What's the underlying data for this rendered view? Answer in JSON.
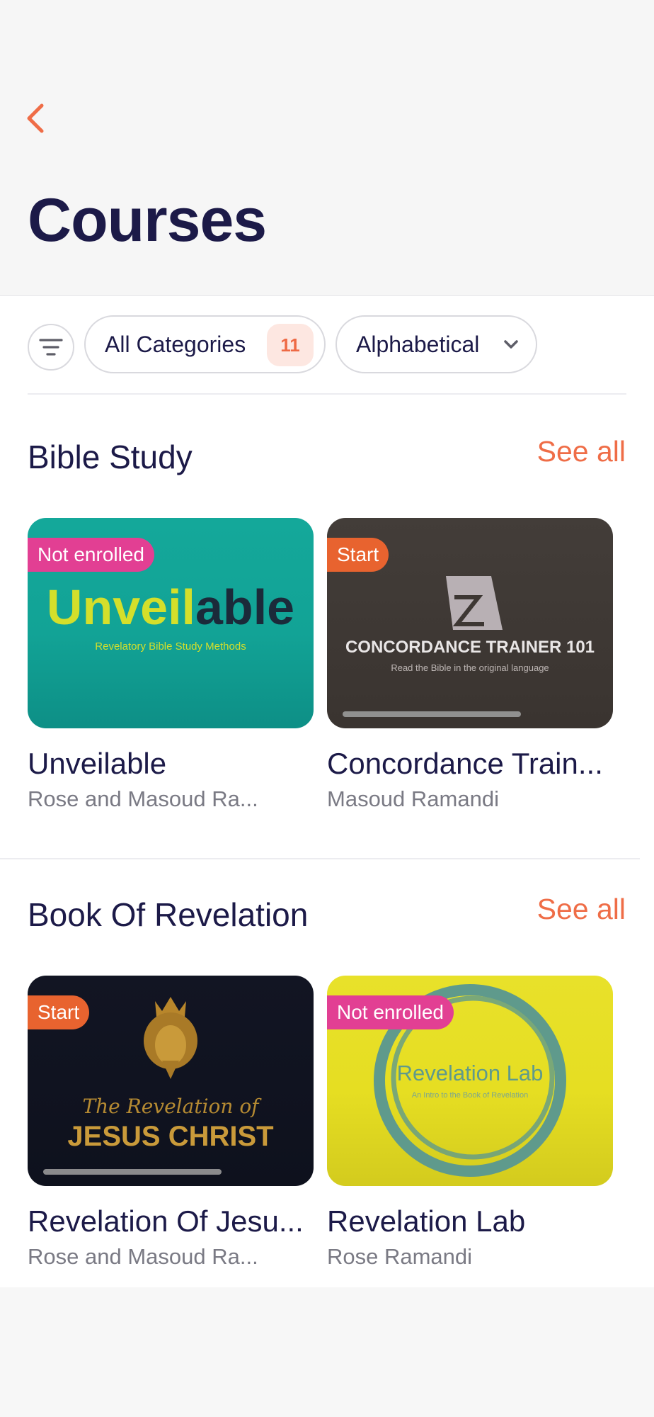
{
  "header": {
    "back_icon": "chevron-left-icon",
    "title": "Courses"
  },
  "filters": {
    "filter_icon": "filter-lines-icon",
    "category_label": "All Categories",
    "category_count": "11",
    "sort_label": "Alphabetical",
    "sort_icon": "chevron-down-icon"
  },
  "sections": [
    {
      "title": "Bible Study",
      "see_all": "See all",
      "courses": [
        {
          "title": "Unveilable",
          "author": "Rose and Masoud Ra...",
          "status": "Not enrolled",
          "thumb_title": "Unveilable",
          "thumb_title_part1": "Unveil",
          "thumb_title_part2": "able",
          "thumb_subtitle": "Revelatory Bible Study Methods"
        },
        {
          "title": "Concordance Train...",
          "author": "Masoud Ramandi",
          "status": "Start",
          "thumb_title": "CONCORDANCE TRAINER 101",
          "thumb_subtitle": "Read the Bible in the original language",
          "progress": 0.7
        }
      ]
    },
    {
      "title": "Book Of Revelation",
      "see_all": "See all",
      "courses": [
        {
          "title": "Revelation Of Jesu...",
          "author": "Rose and Masoud Ra...",
          "status": "Start",
          "thumb_line1": "The Revelation of",
          "thumb_line2": "JESUS CHRIST",
          "progress": 0.7
        },
        {
          "title": "Revelation Lab",
          "author": "Rose Ramandi",
          "status": "Not enrolled",
          "thumb_title": "Revelation Lab",
          "thumb_subtitle": "An Intro to the Book of Revelation"
        }
      ]
    }
  ],
  "colors": {
    "accent": "#ef6d47",
    "title": "#1c1a48",
    "badge_not_enrolled": "#e23f93",
    "badge_start": "#e8632f"
  }
}
